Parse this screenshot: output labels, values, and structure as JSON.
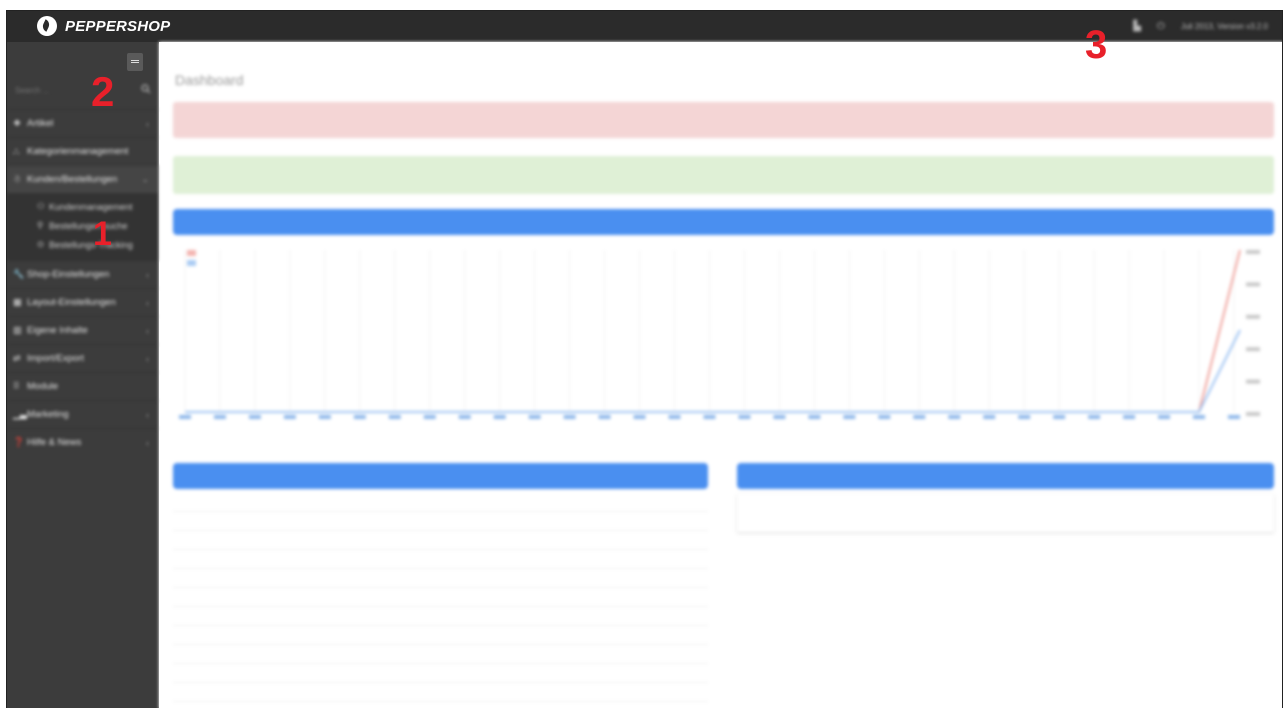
{
  "app": {
    "name": "PEPPERSHOP",
    "version": "Juli 2013, Version v3.2.0"
  },
  "header": {
    "icons": [
      "cart-icon",
      "power-icon"
    ]
  },
  "sidebar": {
    "search_placeholder": "Search ...",
    "items": [
      {
        "label": "Artikel",
        "icon": "cube-icon",
        "glyph": "❖",
        "chevron": "‹"
      },
      {
        "label": "Kategorienmanagement",
        "icon": "sitemap-icon",
        "glyph": "⛬",
        "chevron": ""
      },
      {
        "label": "Kunden/Bestellungen",
        "icon": "users-icon",
        "glyph": "☃",
        "chevron": "⌄"
      },
      {
        "label": "Shop-Einstellungen",
        "icon": "wrench-icon",
        "glyph": "🔧",
        "chevron": "‹"
      },
      {
        "label": "Layout-Einstellungen",
        "icon": "grid-icon",
        "glyph": "▦",
        "chevron": "‹"
      },
      {
        "label": "Eigene Inhalte",
        "icon": "book-icon",
        "glyph": "▥",
        "chevron": "‹"
      },
      {
        "label": "Import/Export",
        "icon": "exchange-icon",
        "glyph": "⇄",
        "chevron": "‹"
      },
      {
        "label": "Module",
        "icon": "apps-icon",
        "glyph": "⠿",
        "chevron": ""
      },
      {
        "label": "Marketing",
        "icon": "bar-chart-icon",
        "glyph": "▁▃",
        "chevron": "‹"
      },
      {
        "label": "Hilfe & News",
        "icon": "help-icon",
        "glyph": "❓",
        "chevron": "‹"
      }
    ],
    "subitems": [
      {
        "label": "Kundenmanagement",
        "glyph": "⚇"
      },
      {
        "label": "Bestellungen suche",
        "glyph": "⚲"
      },
      {
        "label": "Bestellungs-Tracking",
        "glyph": "⊙"
      }
    ]
  },
  "main": {
    "title": "Dashboard"
  },
  "annotations": [
    "1",
    "2",
    "3"
  ],
  "colors": {
    "topbar": "#2b2b2b",
    "sidebar": "#3c3c3c",
    "accent_blue": "#4a8ff0",
    "alert_red": "#f4d5d5",
    "alert_green": "#dff0d6",
    "annotation_red": "#e8202a"
  }
}
